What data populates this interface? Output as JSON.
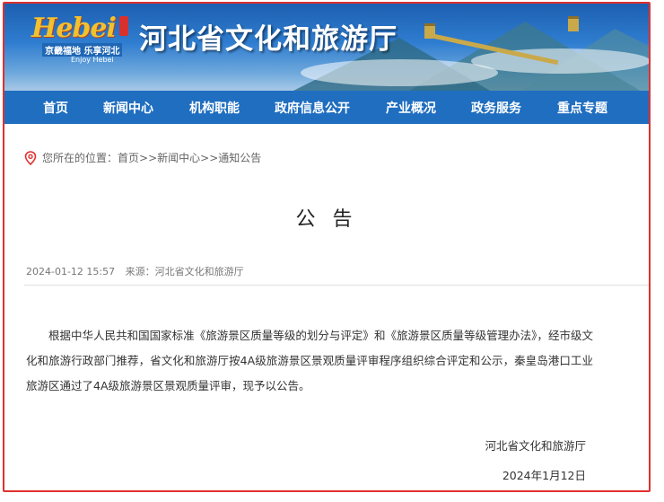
{
  "header": {
    "logo_script": "Hebei",
    "logo_slogan": "京畿福地 乐享河北",
    "logo_english": "Enjoy Hebei",
    "site_title": "河北省文化和旅游厅"
  },
  "nav": {
    "items": [
      "首页",
      "新闻中心",
      "机构职能",
      "政府信息公开",
      "产业概况",
      "政务服务",
      "重点专题"
    ]
  },
  "breadcrumb": {
    "prefix": "您所在的位置：",
    "links": [
      "首页",
      "新闻中心",
      "通知公告"
    ],
    "separator": ">>"
  },
  "article": {
    "title": "公 告",
    "date": "2024-01-12 15:57",
    "source": "来源：河北省文化和旅游厅",
    "body": "根据中华人民共和国国家标准《旅游景区质量等级的划分与评定》和《旅游景区质量等级管理办法》，经市级文化和旅游行政部门推荐，省文化和旅游厅按4A级旅游景区景观质量评审程序组织综合评定和公示，秦皇岛港口工业旅游区通过了4A级旅游景区景观质量评审，现予以公告。",
    "signature_org": "河北省文化和旅游厅",
    "signature_date": "2024年1月12日"
  },
  "colors": {
    "nav_bg": "#1f6ec0",
    "frame_border": "#e0312f",
    "pin": "#e0312f"
  }
}
